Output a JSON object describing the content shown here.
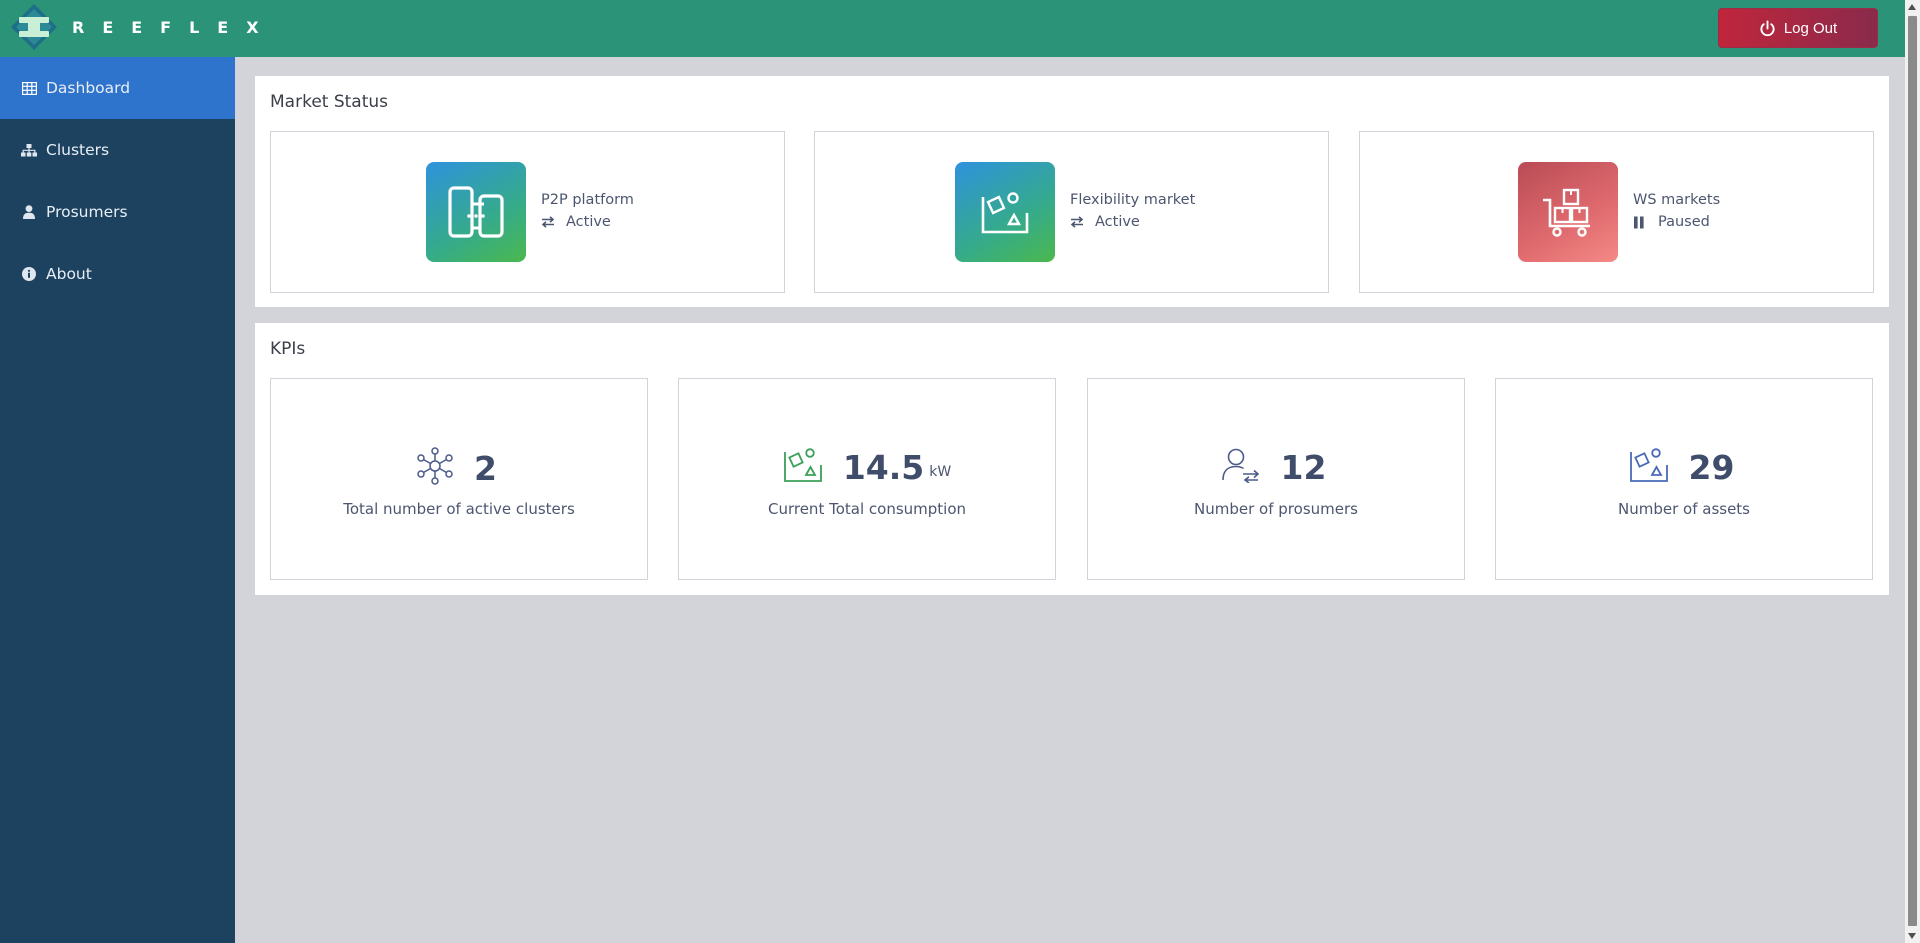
{
  "header": {
    "brand": "REEFLEX",
    "logout_label": "Log Out"
  },
  "sidebar": {
    "items": [
      {
        "label": "Dashboard",
        "icon": "table-icon",
        "active": true
      },
      {
        "label": "Clusters",
        "icon": "sitemap-icon",
        "active": false
      },
      {
        "label": "Prosumers",
        "icon": "user-icon",
        "active": false
      },
      {
        "label": "About",
        "icon": "info-circle-icon",
        "active": false
      }
    ]
  },
  "market_status": {
    "title": "Market Status",
    "cards": [
      {
        "name": "P2P platform",
        "status": "Active",
        "status_icon": "exchange-icon",
        "icon": "p2p-devices-icon"
      },
      {
        "name": "Flexibility market",
        "status": "Active",
        "status_icon": "exchange-icon",
        "icon": "flexibility-icon"
      },
      {
        "name": "WS markets",
        "status": "Paused",
        "status_icon": "pause-icon",
        "icon": "cart-boxes-icon"
      }
    ]
  },
  "kpis": {
    "title": "KPIs",
    "cards": [
      {
        "value": "2",
        "unit": "",
        "label": "Total number of active clusters",
        "icon": "cluster-network-icon"
      },
      {
        "value": "14.5",
        "unit": "kW",
        "label": "Current Total consumption",
        "icon": "consumption-icon"
      },
      {
        "value": "12",
        "unit": "",
        "label": "Number of prosumers",
        "icon": "prosumer-exchange-icon"
      },
      {
        "value": "29",
        "unit": "",
        "label": "Number of assets",
        "icon": "assets-icon"
      }
    ]
  },
  "colors": {
    "header_bg": "#2b9478",
    "sidebar_bg": "#1d4260",
    "sidebar_active": "#2f74cc",
    "logout_red": "#c0263b"
  }
}
